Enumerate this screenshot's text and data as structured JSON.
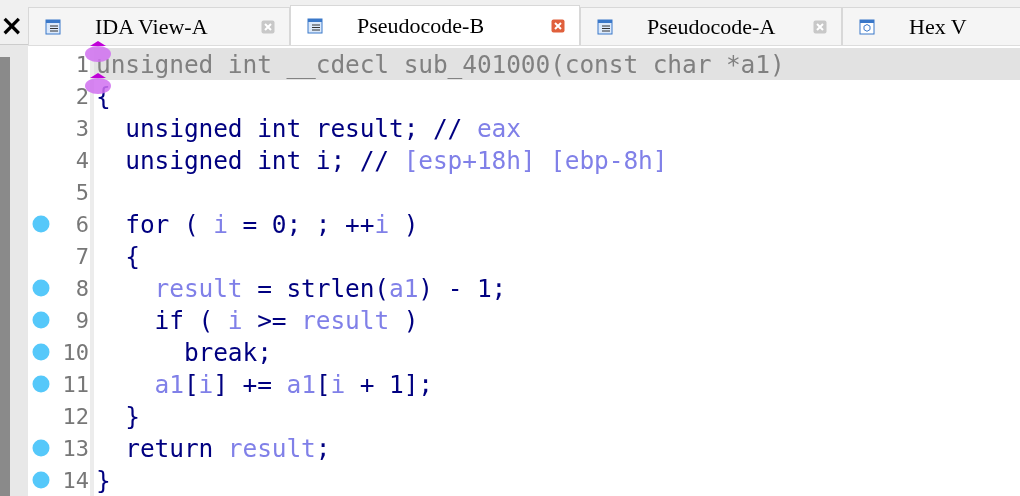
{
  "side_panel": {
    "close": "×"
  },
  "tabs": [
    {
      "label": "IDA View-A",
      "kind": "listing",
      "selected": false
    },
    {
      "label": "Pseudocode-B",
      "kind": "listing",
      "selected": true
    },
    {
      "label": "Pseudocode-A",
      "kind": "listing",
      "selected": false
    },
    {
      "label": "Hex V",
      "kind": "hex",
      "selected": false
    }
  ],
  "lines": [
    {
      "number": "1",
      "breakpoint": false,
      "highlighted": true,
      "marker": true,
      "tokens": [
        {
          "text": "unsigned int __cdecl sub_401000(const char *a1)",
          "kind": "plain"
        }
      ]
    },
    {
      "number": "2",
      "breakpoint": false,
      "highlighted": false,
      "marker": true,
      "tokens": [
        {
          "text": "{",
          "kind": "code"
        }
      ]
    },
    {
      "number": "3",
      "breakpoint": false,
      "highlighted": false,
      "marker": false,
      "tokens": [
        {
          "text": "  unsigned int result; // ",
          "kind": "code"
        },
        {
          "text": "eax",
          "kind": "var"
        }
      ]
    },
    {
      "number": "4",
      "breakpoint": false,
      "highlighted": false,
      "marker": false,
      "tokens": [
        {
          "text": "  unsigned int i; // ",
          "kind": "code"
        },
        {
          "text": "[esp+18h] [ebp-8h]",
          "kind": "var"
        }
      ]
    },
    {
      "number": "5",
      "breakpoint": false,
      "highlighted": false,
      "marker": false
    },
    {
      "number": "6",
      "breakpoint": true,
      "highlighted": false,
      "marker": false,
      "tokens": [
        {
          "text": "  for ( ",
          "kind": "code"
        },
        {
          "text": "i",
          "kind": "var"
        },
        {
          "text": " = 0; ; ++",
          "kind": "code"
        },
        {
          "text": "i",
          "kind": "var"
        },
        {
          "text": " )",
          "kind": "code"
        }
      ]
    },
    {
      "number": "7",
      "breakpoint": false,
      "highlighted": false,
      "marker": false,
      "tokens": [
        {
          "text": "  {",
          "kind": "code"
        }
      ]
    },
    {
      "number": "8",
      "breakpoint": true,
      "highlighted": false,
      "marker": false,
      "tokens": [
        {
          "text": "    result",
          "kind": "var"
        },
        {
          "text": " = strlen(",
          "kind": "code"
        },
        {
          "text": "a1",
          "kind": "var"
        },
        {
          "text": ") - 1;",
          "kind": "code"
        }
      ]
    },
    {
      "number": "9",
      "breakpoint": true,
      "highlighted": false,
      "marker": false,
      "tokens": [
        {
          "text": "    if ( ",
          "kind": "code"
        },
        {
          "text": "i",
          "kind": "var"
        },
        {
          "text": " >= ",
          "kind": "code"
        },
        {
          "text": "result",
          "kind": "var"
        },
        {
          "text": " )",
          "kind": "code"
        }
      ]
    },
    {
      "number": "10",
      "breakpoint": true,
      "highlighted": false,
      "marker": false,
      "tokens": [
        {
          "text": "      break;",
          "kind": "code"
        }
      ]
    },
    {
      "number": "11",
      "breakpoint": true,
      "highlighted": false,
      "marker": false,
      "tokens": [
        {
          "text": "    a1",
          "kind": "var"
        },
        {
          "text": "[",
          "kind": "code"
        },
        {
          "text": "i",
          "kind": "var"
        },
        {
          "text": "] += ",
          "kind": "code"
        },
        {
          "text": "a1",
          "kind": "var"
        },
        {
          "text": "[",
          "kind": "code"
        },
        {
          "text": "i",
          "kind": "var"
        },
        {
          "text": " + 1];",
          "kind": "code"
        }
      ]
    },
    {
      "number": "12",
      "breakpoint": false,
      "highlighted": false,
      "marker": false,
      "tokens": [
        {
          "text": "  }",
          "kind": "code"
        }
      ]
    },
    {
      "number": "13",
      "breakpoint": true,
      "highlighted": false,
      "marker": false,
      "tokens": [
        {
          "text": "  return ",
          "kind": "code"
        },
        {
          "text": "result",
          "kind": "var"
        },
        {
          "text": ";",
          "kind": "code"
        }
      ]
    },
    {
      "number": "14",
      "breakpoint": true,
      "highlighted": false,
      "marker": false,
      "tokens": [
        {
          "text": "}",
          "kind": "code"
        }
      ]
    }
  ]
}
